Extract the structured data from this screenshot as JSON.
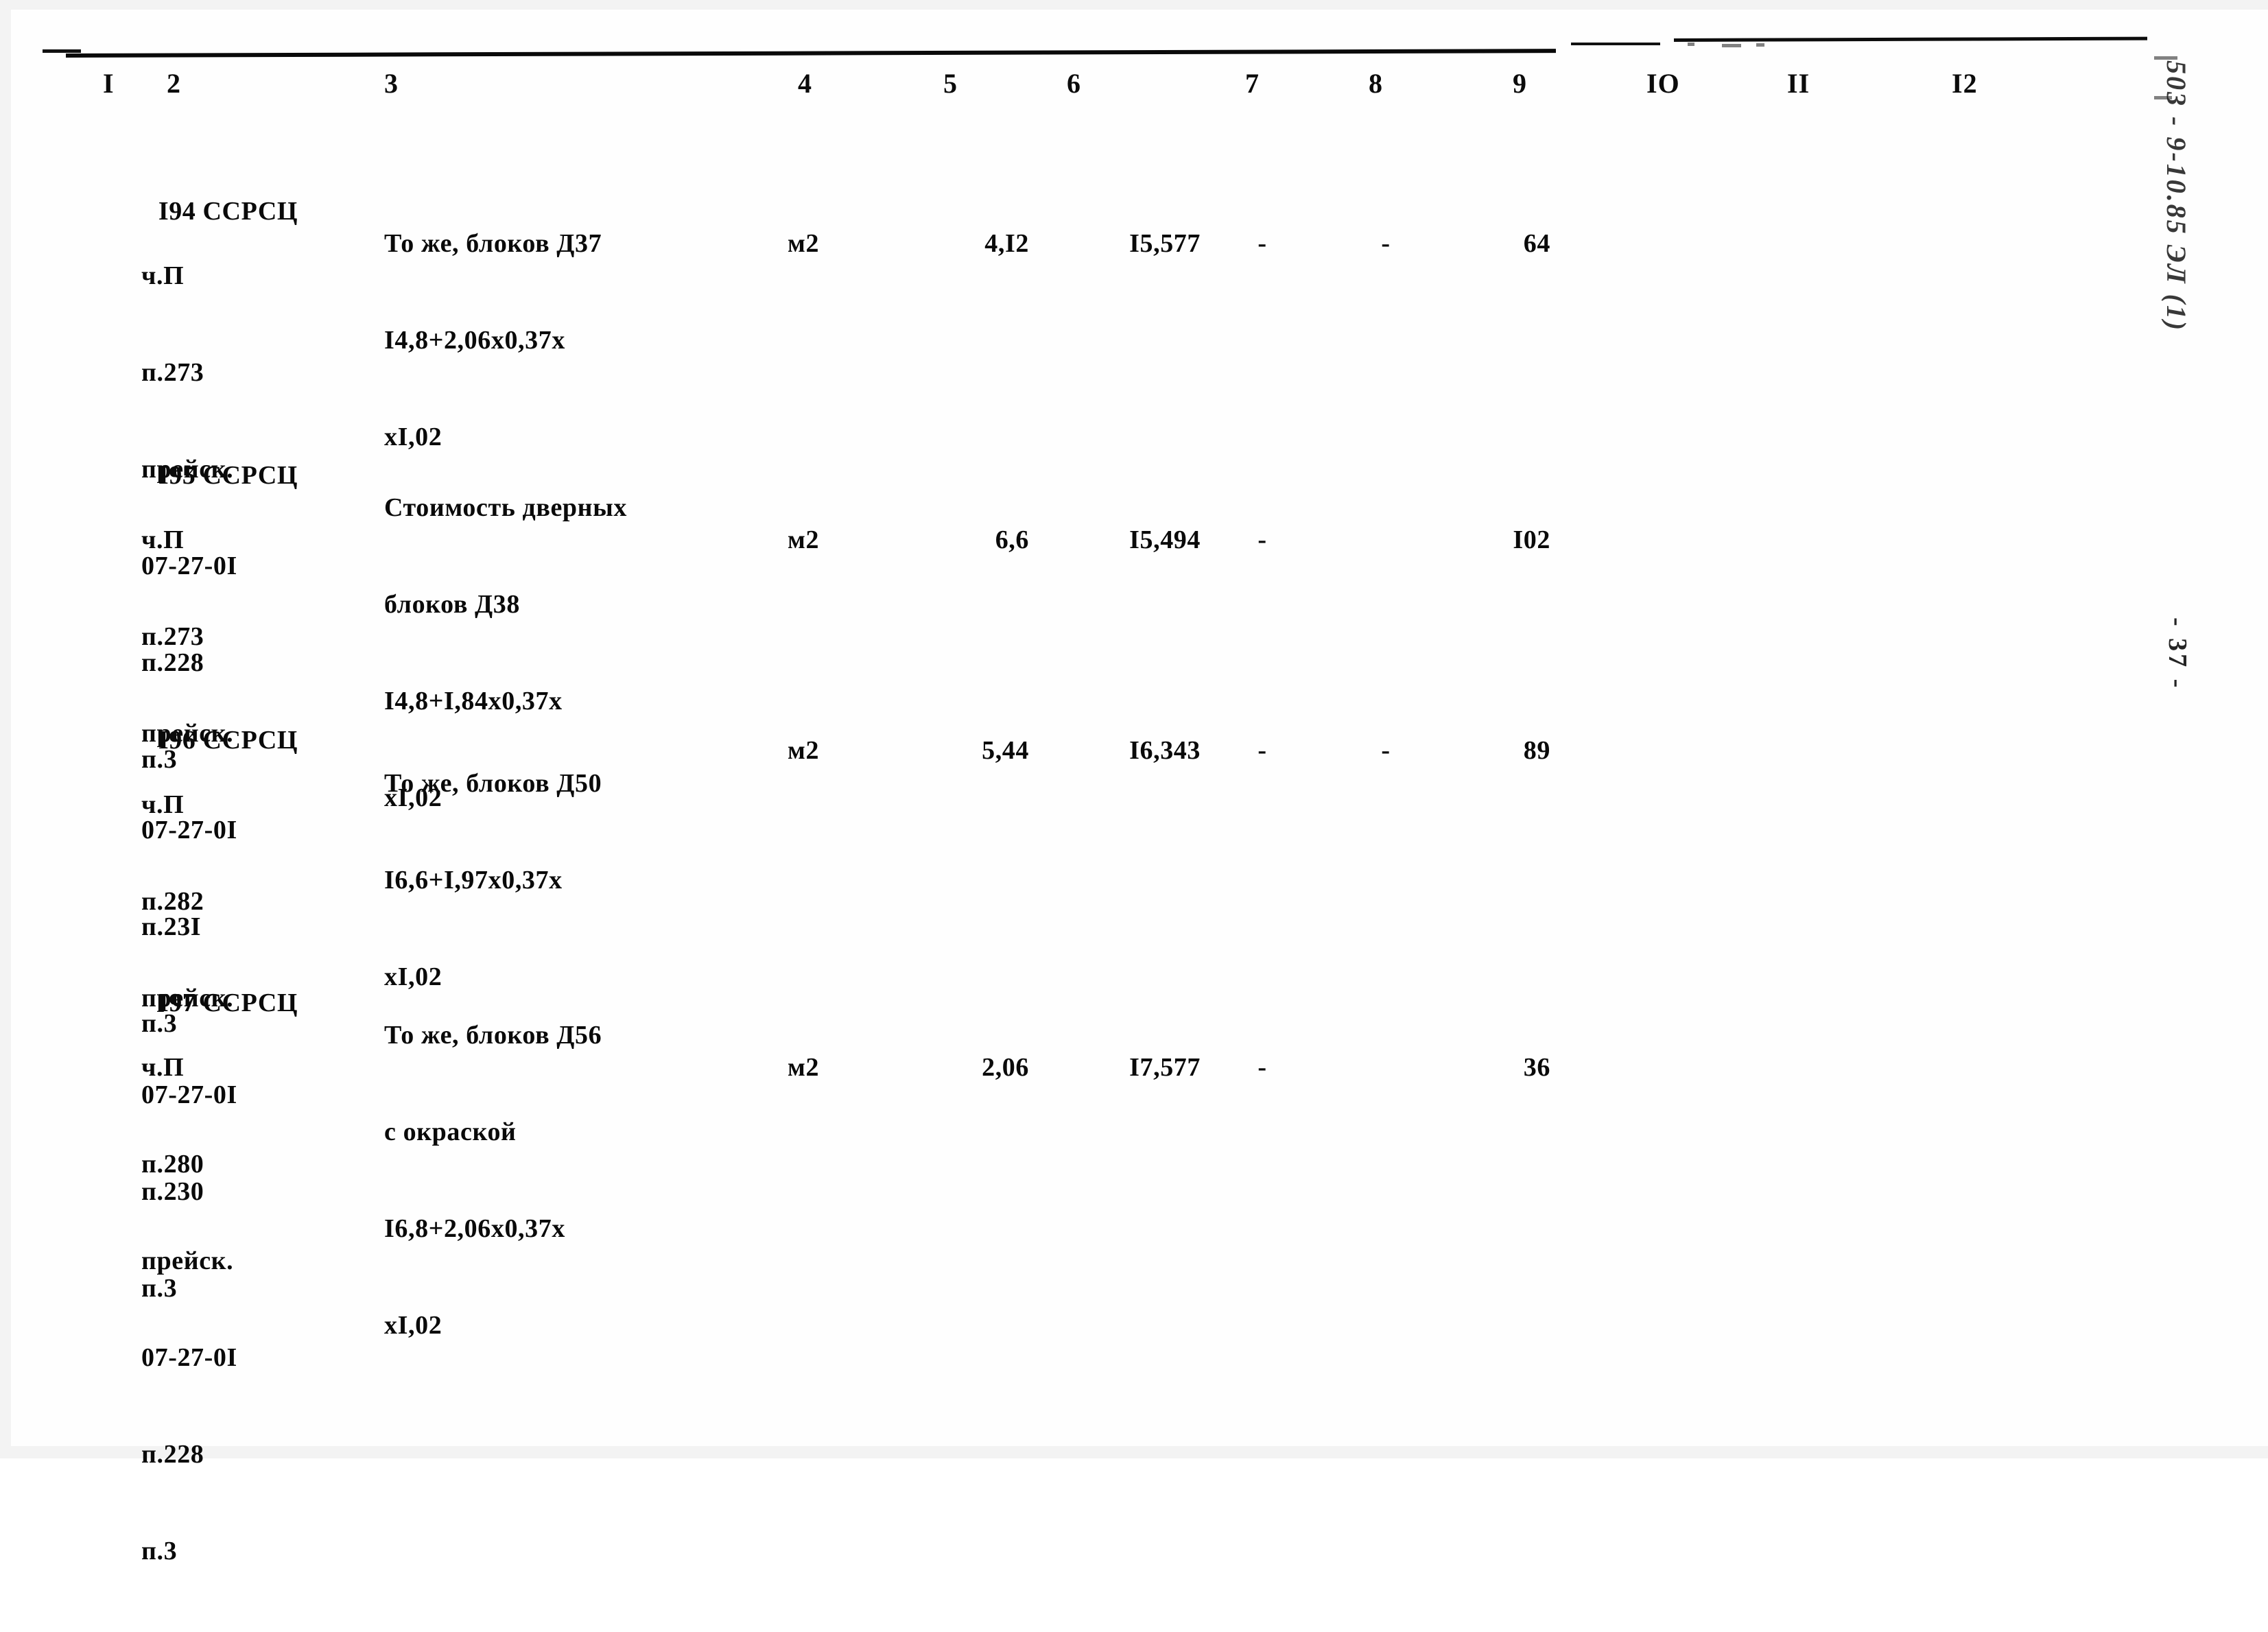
{
  "document": {
    "type": "scanned-cost-estimate-table",
    "page_number": "- 37 -",
    "margin_stamp": "503 - 9-10.85 ЭЛ (1)"
  },
  "table": {
    "column_numbers": [
      "I",
      "2",
      "3",
      "4",
      "5",
      "6",
      "7",
      "8",
      "9",
      "IO",
      "II",
      "I2"
    ],
    "rows": [
      {
        "no": "I94",
        "code_lines": [
          "ССРСЦ",
          "ч.П",
          "п.273",
          "прейск.",
          "07-27-0I",
          "п.228",
          "п.3"
        ],
        "description_lines": [
          "То же, блоков Д37",
          "I4,8+2,06х0,37х",
          "хI,02"
        ],
        "unit": "м2",
        "quantity": "4,I2",
        "price": "I5,577",
        "col7": "-",
        "col8": "-",
        "col9": "64",
        "col10": "",
        "col11": "",
        "col12": ""
      },
      {
        "no": "I95",
        "code_lines": [
          "ССРСЦ",
          "ч.П",
          "п.273",
          "прейск.",
          "07-27-0I",
          "п.23I",
          "п.3"
        ],
        "description_lines": [
          "Стоимость дверных",
          "блоков Д38",
          "I4,8+I,84х0,37х",
          "хI,02"
        ],
        "unit": "м2",
        "quantity": "6,6",
        "price": "I5,494",
        "col7": "-",
        "col8": "",
        "col9": "I02",
        "col10": "",
        "col11": "",
        "col12": ""
      },
      {
        "no": "I96",
        "code_lines": [
          "ССРСЦ",
          "ч.П",
          "п.282",
          "прейск.",
          "07-27-0I",
          "п.230",
          "п.3"
        ],
        "description_lines": [
          "То же, блоков Д50",
          "I6,6+I,97х0,37х",
          "хI,02"
        ],
        "unit": "м2",
        "quantity": "5,44",
        "price": "I6,343",
        "col7": "-",
        "col8": "-",
        "col9": "89",
        "col10": "",
        "col11": "",
        "col12": ""
      },
      {
        "no": "I97",
        "code_lines": [
          "ССРСЦ",
          "ч.П",
          "п.280",
          "прейск.",
          "07-27-0I",
          "п.228",
          "п.3"
        ],
        "description_lines": [
          "То же, блоков Д56",
          "с окраской",
          "I6,8+2,06х0,37х",
          "хI,02"
        ],
        "unit": "м2",
        "quantity": "2,06",
        "price": "I7,577",
        "col7": "-",
        "col8": "",
        "col9": "36",
        "col10": "",
        "col11": "",
        "col12": ""
      }
    ]
  }
}
